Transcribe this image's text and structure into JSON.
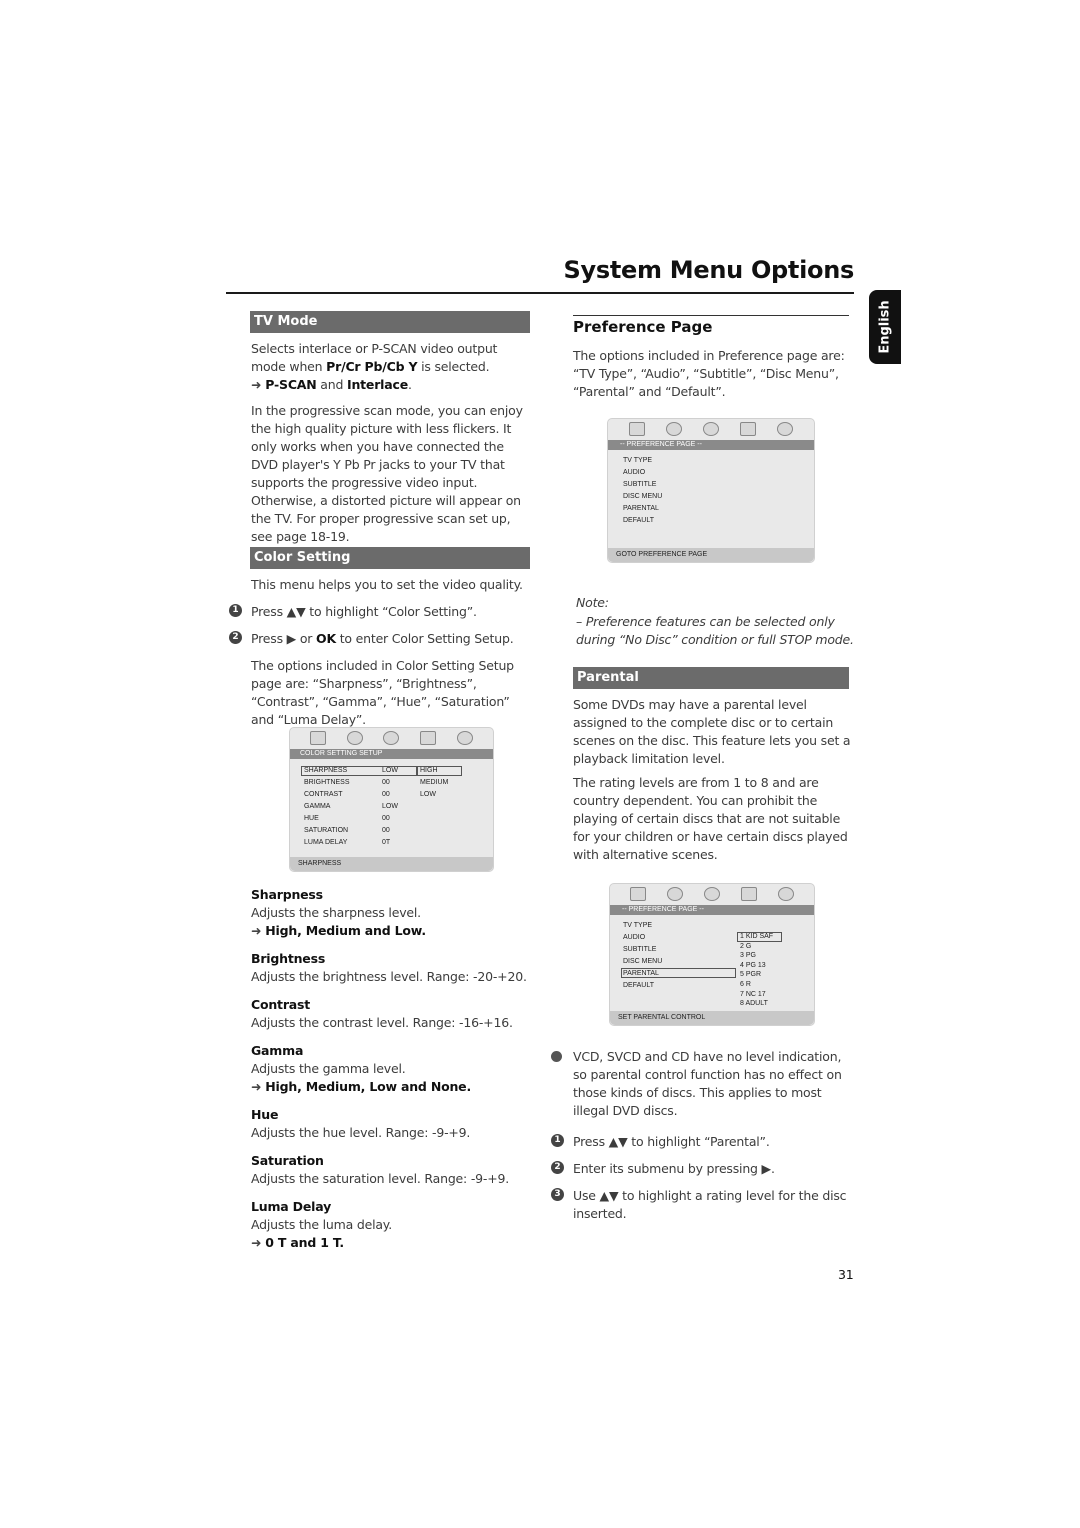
{
  "page": {
    "title": "System Menu Options",
    "language_tab": "English",
    "page_number": "31"
  },
  "left": {
    "tv_mode": {
      "heading": "TV Mode",
      "p1_a": "Selects interlace or P-SCAN video output mode when ",
      "p1_bold": "Pr/Cr Pb/Cb Y",
      "p1_b": " is selected.",
      "opt_a": "P-SCAN",
      "opt_and": " and ",
      "opt_b": "Interlace",
      "opt_end": ".",
      "p2": "In the progressive scan mode, you can enjoy the high quality picture with less flickers. It only works when you have connected the DVD player's Y Pb Pr jacks to your TV that supports the progressive video input. Otherwise, a distorted picture will appear on the TV. For proper progressive scan set up, see page 18-19."
    },
    "color_setting": {
      "heading": "Color Setting",
      "intro": "This menu helps you to set the video quality.",
      "step1": {
        "num": "1",
        "a": "Press ▲▼  to highlight “Color Setting”."
      },
      "step2": {
        "num": "2",
        "a": "Press ▶ or ",
        "bold": "OK",
        "b": " to enter Color Setting Setup."
      },
      "options_text": "The options included in Color Setting Setup page are: “Sharpness”, “Brightness”, “Contrast”, “Gamma”, “Hue”, “Saturation” and “Luma Delay”."
    },
    "osd_color": {
      "bar": "COLOR SETTING SETUP",
      "rows": [
        {
          "label": "SHARPNESS",
          "value": "LOW"
        },
        {
          "label": "BRIGHTNESS",
          "value": "00"
        },
        {
          "label": "CONTRAST",
          "value": "00"
        },
        {
          "label": "GAMMA",
          "value": "LOW"
        },
        {
          "label": "HUE",
          "value": "00"
        },
        {
          "label": "SATURATION",
          "value": "00"
        },
        {
          "label": "LUMA DELAY",
          "value": "0T"
        }
      ],
      "submenu": [
        "HIGH",
        "MEDIUM",
        "LOW"
      ],
      "footer": "SHARPNESS"
    },
    "items": [
      {
        "name": "Sharpness",
        "desc": "Adjusts the sharpness level.",
        "opts": "High, Medium and Low."
      },
      {
        "name": "Brightness",
        "desc": "Adjusts the brightness level. Range: -20-+20."
      },
      {
        "name": "Contrast",
        "desc": "Adjusts the contrast level. Range: -16-+16."
      },
      {
        "name": "Gamma",
        "desc": "Adjusts the gamma level.",
        "opts": "High, Medium, Low and None."
      },
      {
        "name": "Hue",
        "desc": "Adjusts the hue level. Range: -9-+9."
      },
      {
        "name": "Saturation",
        "desc": "Adjusts the saturation level. Range: -9-+9."
      },
      {
        "name": "Luma Delay",
        "desc": "Adjusts the luma delay.",
        "opts": "0 T and 1 T."
      }
    ]
  },
  "right": {
    "preference": {
      "heading": "Preference Page",
      "text": "The options included in Preference page are: “TV Type”, “Audio”, “Subtitle”, “Disc Menu”, “Parental” and “Default”."
    },
    "osd_pref": {
      "bar": "-- PREFERENCE PAGE --",
      "rows": [
        "TV TYPE",
        "AUDIO",
        "SUBTITLE",
        "DISC MENU",
        "PARENTAL",
        "DEFAULT"
      ],
      "footer": "GOTO PREFERENCE PAGE"
    },
    "note": {
      "label": "Note:",
      "text": "–   Preference features can be selected only during “No Disc” condition or full STOP mode."
    },
    "parental": {
      "heading": "Parental",
      "p1": "Some DVDs may have a parental level assigned to the complete disc or to certain scenes on the disc. This feature lets you set a playback limitation level.",
      "p2": "The rating levels are from 1 to 8 and are country dependent. You can prohibit the playing of certain discs that are not suitable for your children or have certain discs played with alternative scenes."
    },
    "osd_parental": {
      "bar": "-- PREFERENCE PAGE --",
      "rows": [
        "TV TYPE",
        "AUDIO",
        "SUBTITLE",
        "DISC MENU",
        "PARENTAL",
        "DEFAULT"
      ],
      "ratings": [
        "1 KID SAF",
        "2 G",
        "3 PG",
        "4 PG 13",
        "5 PGR",
        "6 R",
        "7 NC 17",
        "8 ADULT"
      ],
      "footer": "SET PARENTAL CONTROL"
    },
    "bullet_text": "VCD, SVCD and CD have no level indication, so parental control function has no effect on those kinds of discs. This applies to most illegal DVD discs.",
    "steps": [
      {
        "num": "1",
        "text": "Press ▲▼  to highlight “Parental”."
      },
      {
        "num": "2",
        "text": "Enter its submenu by pressing ▶."
      },
      {
        "num": "3",
        "text": "Use ▲▼  to highlight a rating level for the disc inserted."
      }
    ]
  }
}
